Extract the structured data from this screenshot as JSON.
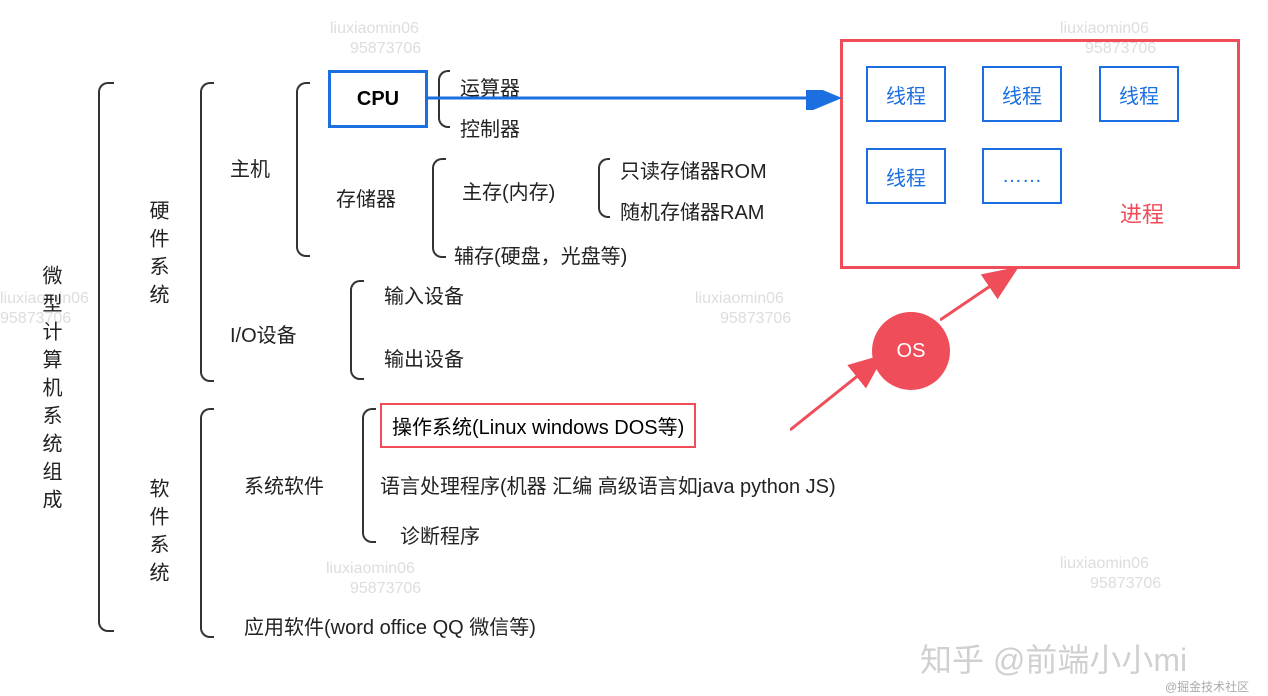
{
  "root": "微型计算机系统组成",
  "hardware": {
    "title": "硬件系统",
    "host": {
      "title": "主机",
      "cpu": "CPU",
      "cpu_children": {
        "alu": "运算器",
        "control": "控制器"
      },
      "memory": {
        "title": "存储器",
        "main": "主存(内存)",
        "rom": "只读存储器ROM",
        "ram": "随机存储器RAM",
        "aux": "辅存(硬盘，光盘等)"
      }
    },
    "io": {
      "title": "I/O设备",
      "input": "输入设备",
      "output": "输出设备"
    }
  },
  "software": {
    "title": "软件系统",
    "system": {
      "title": "系统软件",
      "os": "操作系统(Linux windows DOS等)",
      "lang": "语言处理程序(机器 汇编 高级语言如java python JS)",
      "diag": "诊断程序"
    },
    "app": "应用软件(word office QQ 微信等)"
  },
  "os_circle": "OS",
  "process": {
    "label": "进程",
    "thread": "线程",
    "more": "……"
  },
  "watermarks": {
    "user": "liuxiaomin06",
    "num": "95873706",
    "zhihu": "知乎 @前端小小mi",
    "juejin": "@掘金技术社区"
  }
}
